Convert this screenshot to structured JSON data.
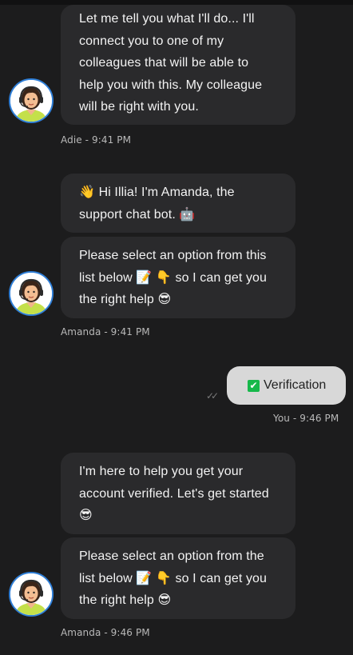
{
  "messages": [
    {
      "lines": [
        "Let me tell you what I'll do... I'll",
        "connect you to one of my",
        "colleagues that will be able to",
        "help you with this. My colleague",
        "will be right with you."
      ],
      "meta": "Adie - 9:41 PM"
    },
    {
      "b1_lines": [
        "👋 Hi Illia! I'm Amanda, the",
        "support chat bot. 🤖"
      ],
      "b2_lines": [
        "Please select an option from this",
        "list below 📝 👇 so I can get you",
        "the right help 😎"
      ],
      "meta": "Amanda - 9:41 PM"
    },
    {
      "user_text": "Verification",
      "user_icon": "check-mark-box-icon",
      "check_glyph": "✔",
      "ticks": "✓✓",
      "meta": "You - 9:46 PM"
    },
    {
      "b1_lines": [
        "I'm here to help you get your",
        "account verified. Let's get started",
        "😎"
      ],
      "b2_lines": [
        "Please select an option from the",
        "list below 📝 👇 so I can get you",
        "the right help 😎"
      ],
      "meta": "Amanda - 9:46 PM"
    }
  ],
  "colors": {
    "background": "#1c1c1d",
    "bot_bubble": "#2a2a2c",
    "user_bubble": "#d8d8d8",
    "avatar_ring": "#2f7fd8",
    "check_green": "#16b84a"
  },
  "icons": [
    "agent-avatar-icon",
    "check-mark-box-icon",
    "double-tick-icon"
  ]
}
